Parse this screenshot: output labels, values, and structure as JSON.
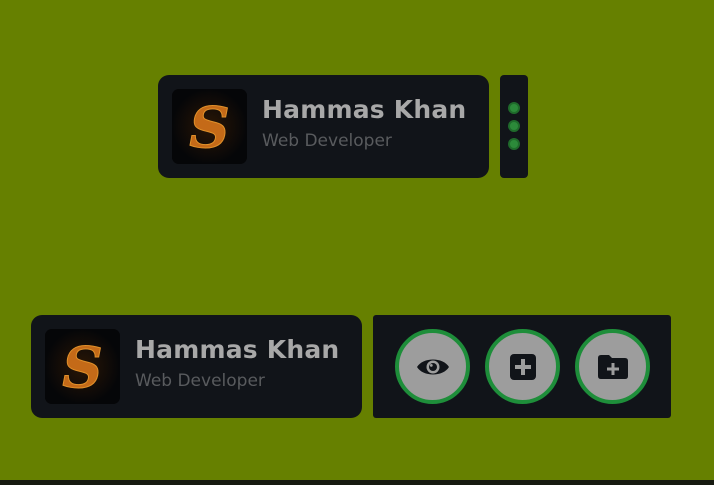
{
  "profile_card_top": {
    "name": "Hammas Khan",
    "role": "Web Developer",
    "avatar_icon": "s-monogram-icon",
    "menu_icon": "vertical-dots-icon"
  },
  "profile_card_bottom": {
    "name": "Hammas Khan",
    "role": "Web Developer",
    "avatar_icon": "s-monogram-icon"
  },
  "actions": [
    {
      "id": "view",
      "icon": "eye-icon"
    },
    {
      "id": "add",
      "icon": "plus-square-icon"
    },
    {
      "id": "add-folder",
      "icon": "folder-plus-icon"
    }
  ],
  "colors": {
    "background": "#668000",
    "card": "#111419",
    "accent_green": "#1e8e3a",
    "button_fill": "#9d9d9d",
    "name_text": "#a8a8a8",
    "role_text": "#595b5e",
    "monogram": "#c46a18"
  }
}
